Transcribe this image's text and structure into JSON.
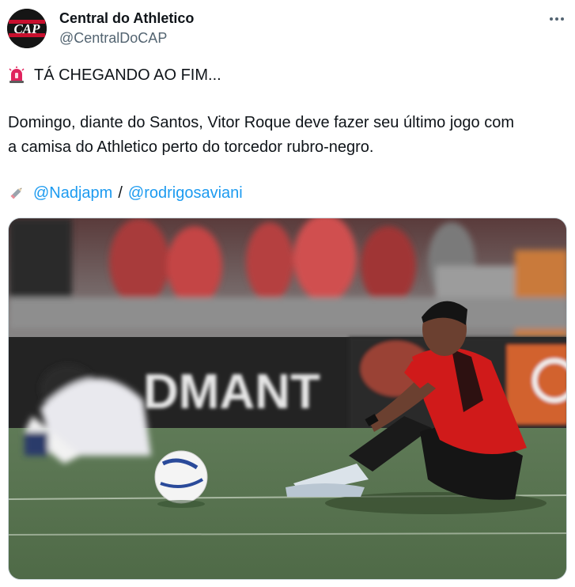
{
  "author": {
    "name": "Central do Athletico",
    "handle": "@CentralDoCAP",
    "avatar_text": "CAP",
    "avatar_icon": "cap-logo"
  },
  "more_icon": "ellipsis-icon",
  "tweet": {
    "emoji": "rotating-light-icon",
    "headline": "TÁ CHEGANDO AO FIM...",
    "body_line1": "Domingo, diante do Santos, Vitor Roque deve fazer seu último jogo com",
    "body_line2": "a camisa do Athletico perto do torcedor rubro-negro.",
    "credit_icon": "pencil-icon",
    "mention1": "@Nadjapm",
    "separator": "/",
    "mention2": "@rodrigosaviani"
  },
  "photo": {
    "board_text": "DMANT"
  },
  "colors": {
    "link": "#1d9bf0",
    "text": "#0f1419",
    "secondary": "#536471",
    "jersey_red": "#d01a1a"
  }
}
